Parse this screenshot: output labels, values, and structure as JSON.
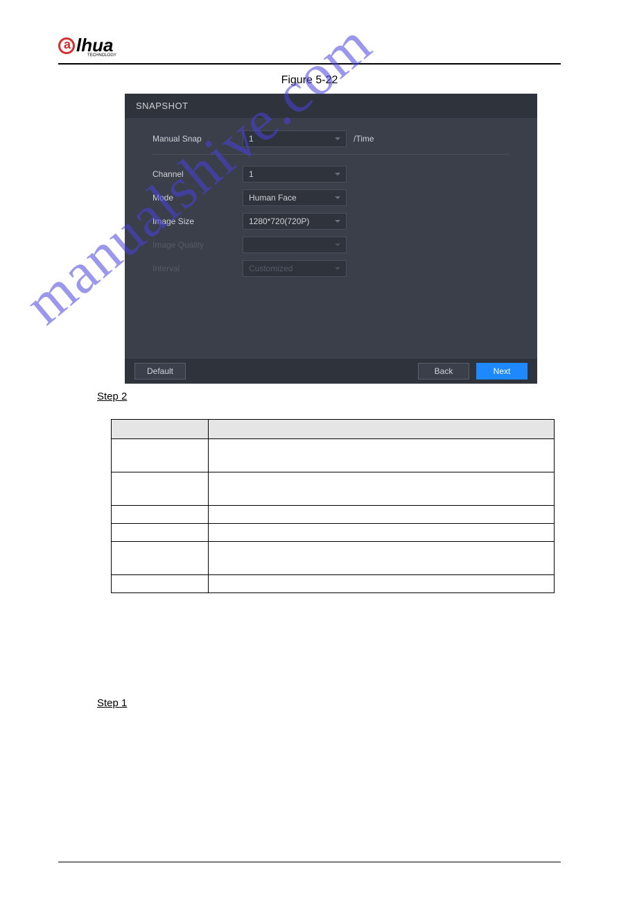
{
  "logo": {
    "brand": "lhua",
    "subtext": "TECHNOLOGY"
  },
  "figure_title": "Figure 5-22",
  "snapshot": {
    "title": "SNAPSHOT",
    "rows": {
      "manual_snap": {
        "label": "Manual Snap",
        "value": "1",
        "suffix": "/Time"
      },
      "channel": {
        "label": "Channel",
        "value": "1"
      },
      "mode": {
        "label": "Mode",
        "value": "Human Face"
      },
      "image_size": {
        "label": "Image Size",
        "value": "1280*720(720P)"
      },
      "image_quality": {
        "label": "Image Quality",
        "value": ""
      },
      "interval": {
        "label": "Interval",
        "value": "Customized"
      }
    },
    "buttons": {
      "default": "Default",
      "back": "Back",
      "next": "Next"
    }
  },
  "step2": "Step 2",
  "step1": "Step 1",
  "watermark": "manualshive.com"
}
